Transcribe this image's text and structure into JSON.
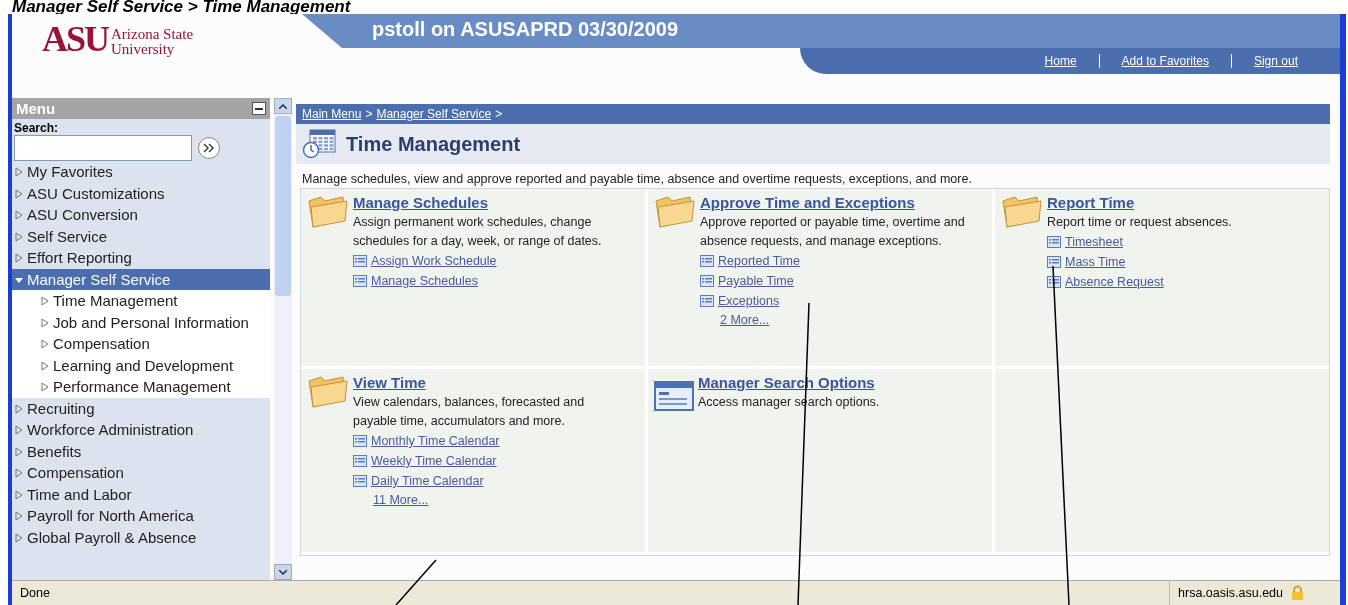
{
  "caption": "Manager Self Service > Time Management",
  "header": {
    "logo_mark": "ASU",
    "logo_text": [
      "Arizona State",
      "University"
    ],
    "banner": "pstoll on ASUSAPRD 03/30/2009",
    "nav": [
      "Home",
      "Add to Favorites",
      "Sign out"
    ]
  },
  "menu": {
    "title": "Menu",
    "search_label": "Search:",
    "items": [
      {
        "label": "My Favorites",
        "expanded": false,
        "selected": false
      },
      {
        "label": "ASU Customizations",
        "expanded": false,
        "selected": false
      },
      {
        "label": "ASU Conversion",
        "expanded": false,
        "selected": false
      },
      {
        "label": "Self Service",
        "expanded": false,
        "selected": false
      },
      {
        "label": "Effort Reporting",
        "expanded": false,
        "selected": false
      },
      {
        "label": "Manager Self Service",
        "expanded": true,
        "selected": true,
        "children": [
          {
            "label": "Time Management",
            "expanded": false,
            "selected": false
          },
          {
            "label": "Job and Personal Information",
            "expanded": false,
            "selected": false
          },
          {
            "label": "Compensation",
            "expanded": false,
            "selected": false
          },
          {
            "label": "Learning and Development",
            "expanded": false,
            "selected": false
          },
          {
            "label": "Performance Management",
            "expanded": false,
            "selected": false
          }
        ]
      },
      {
        "label": "Recruiting",
        "expanded": false,
        "selected": false
      },
      {
        "label": "Workforce Administration",
        "expanded": false,
        "selected": false
      },
      {
        "label": "Benefits",
        "expanded": false,
        "selected": false
      },
      {
        "label": "Compensation",
        "expanded": false,
        "selected": false
      },
      {
        "label": "Time and Labor",
        "expanded": false,
        "selected": false
      },
      {
        "label": "Payroll for North America",
        "expanded": false,
        "selected": false
      },
      {
        "label": "Global Payroll & Absence",
        "expanded": false,
        "selected": false
      }
    ]
  },
  "breadcrumb": [
    "Main Menu",
    "Manager Self Service"
  ],
  "breadcrumb_separator": ">",
  "page_title": "Time Management",
  "page_description": "Manage schedules, view and approve reported and payable time, absence and overtime requests, exceptions, and more.",
  "tiles": [
    {
      "kind": "folder",
      "title": "Manage Schedules",
      "description": "Assign permanent work schedules, change schedules for a day, week, or range of dates.",
      "links": [
        "Assign Work Schedule",
        "Manage Schedules"
      ]
    },
    {
      "kind": "folder",
      "title": "Approve Time and Exceptions",
      "description": "Approve reported or payable time, overtime and absence requests, and manage exceptions.",
      "links": [
        "Reported Time",
        "Payable Time",
        "Exceptions"
      ],
      "more": "2 More..."
    },
    {
      "kind": "folder",
      "title": "Report Time",
      "description": "Report time or request absences.",
      "links": [
        "Timesheet",
        "Mass Time",
        "Absence Request"
      ]
    },
    {
      "kind": "folder",
      "title": "View Time",
      "description": "View calendars, balances, forecasted and payable time, accumulators and more.",
      "links": [
        "Monthly Time Calendar",
        "Weekly Time Calendar",
        "Daily Time Calendar"
      ],
      "more": "11 More..."
    },
    {
      "kind": "page",
      "title": "Manager Search Options",
      "description": "Access manager search options."
    },
    {
      "kind": "empty"
    }
  ],
  "status_bar": {
    "text": "Done",
    "host": "hrsa.oasis.asu.edu"
  }
}
